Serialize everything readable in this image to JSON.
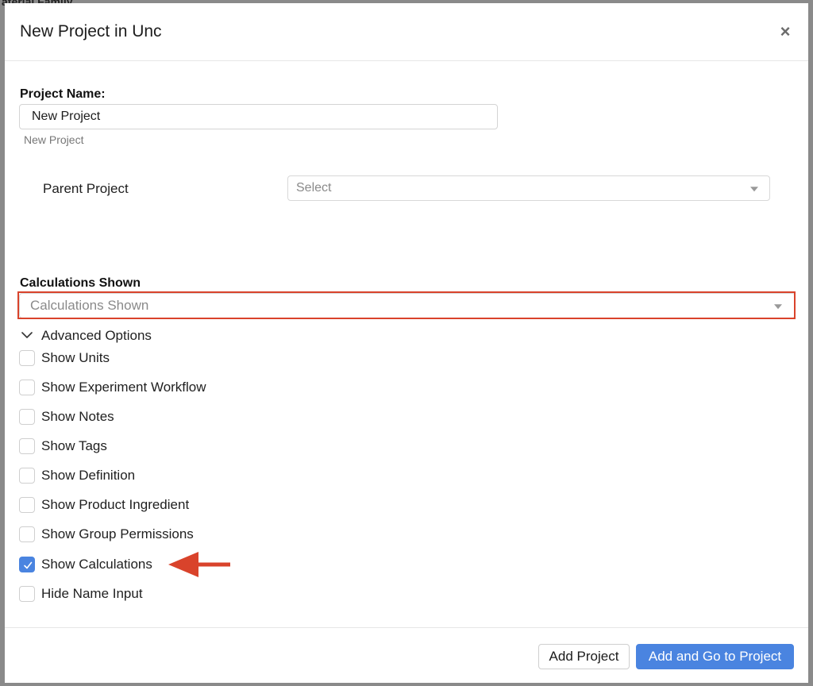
{
  "backdrop": {
    "partial_text": "aterial Family"
  },
  "modal": {
    "title": "New Project in Unc",
    "close_symbol": "×"
  },
  "project_name": {
    "label": "Project Name:",
    "value": "New Project",
    "hint": "New Project"
  },
  "parent_project": {
    "label": "Parent Project",
    "placeholder": "Select"
  },
  "calculations_shown": {
    "label": "Calculations Shown",
    "placeholder": "Calculations Shown"
  },
  "advanced_options": {
    "label": "Advanced Options",
    "expanded": true,
    "items": [
      {
        "label": "Show Units",
        "checked": false
      },
      {
        "label": "Show Experiment Workflow",
        "checked": false
      },
      {
        "label": "Show Notes",
        "checked": false
      },
      {
        "label": "Show Tags",
        "checked": false
      },
      {
        "label": "Show Definition",
        "checked": false
      },
      {
        "label": "Show Product Ingredient",
        "checked": false
      },
      {
        "label": "Show Group Permissions",
        "checked": false
      },
      {
        "label": "Show Calculations",
        "checked": true
      },
      {
        "label": "Hide Name Input",
        "checked": false
      }
    ]
  },
  "footer": {
    "add_project_label": "Add Project",
    "add_and_go_label": "Add and Go to Project"
  },
  "colors": {
    "primary": "#4a84e0",
    "annotation": "#d9432b"
  },
  "icons": {
    "close": "close-icon",
    "chevron": "chevron-down-icon",
    "caret": "caret-down-icon",
    "check": "checkmark-icon",
    "arrow": "arrow-left-icon"
  }
}
